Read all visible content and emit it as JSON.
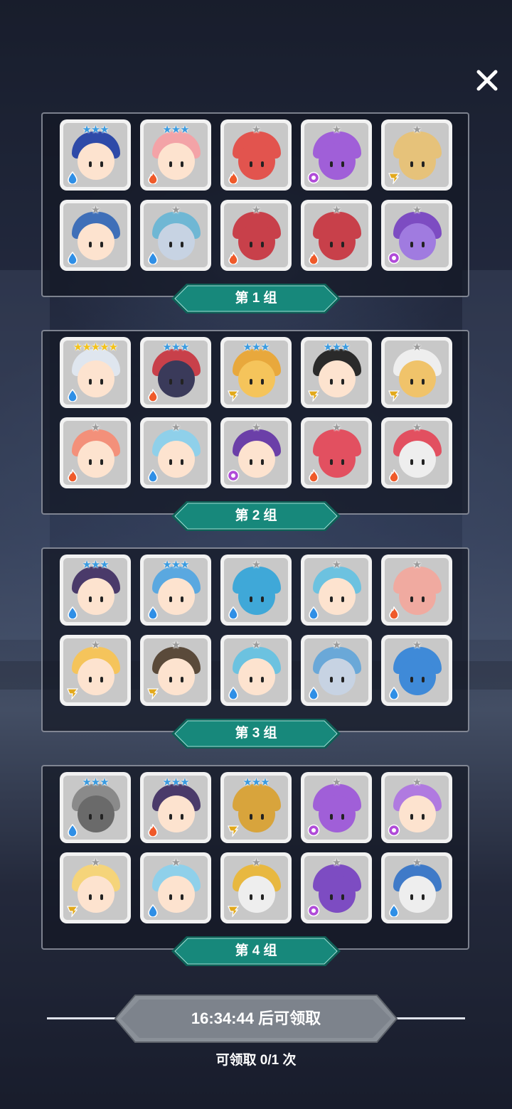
{
  "close_icon": "close-icon",
  "groups": [
    {
      "label": "第 1 组",
      "cards": [
        {
          "stars": "★★★",
          "tier": "blue",
          "element": "water",
          "color": "#2e4aa8",
          "skin": "#fde3cf"
        },
        {
          "stars": "★★★",
          "tier": "blue",
          "element": "fire",
          "color": "#f3a3a7",
          "skin": "#fde3cf"
        },
        {
          "stars": "★",
          "tier": "silver",
          "element": "fire",
          "color": "#e2544e",
          "skin": "#e2544e"
        },
        {
          "stars": "★",
          "tier": "silver",
          "element": "dark",
          "color": "#a05fd8",
          "skin": "#a05fd8"
        },
        {
          "stars": "★",
          "tier": "silver",
          "element": "wind",
          "color": "#e6c27a",
          "skin": "#e6c27a"
        },
        {
          "stars": "★",
          "tier": "silver",
          "element": "water",
          "color": "#3f6fb8",
          "skin": "#fde3cf"
        },
        {
          "stars": "★",
          "tier": "silver",
          "element": "water",
          "color": "#6fb7d4",
          "skin": "#c7d3e3"
        },
        {
          "stars": "★",
          "tier": "silver",
          "element": "fire",
          "color": "#c8404a",
          "skin": "#c8404a"
        },
        {
          "stars": "★",
          "tier": "silver",
          "element": "fire",
          "color": "#c8404a",
          "skin": "#c8404a"
        },
        {
          "stars": "★",
          "tier": "silver",
          "element": "dark",
          "color": "#7d4cc2",
          "skin": "#a07be0"
        }
      ]
    },
    {
      "label": "第 2 组",
      "cards": [
        {
          "stars": "★★★★★",
          "tier": "gold",
          "element": "water",
          "color": "#dfe6ef",
          "skin": "#fde3cf"
        },
        {
          "stars": "★★★",
          "tier": "blue",
          "element": "fire",
          "color": "#c8404a",
          "skin": "#3a3a5a"
        },
        {
          "stars": "★★★",
          "tier": "blue",
          "element": "wind",
          "color": "#e8a83c",
          "skin": "#f5c45b"
        },
        {
          "stars": "★★★",
          "tier": "blue",
          "element": "wind",
          "color": "#2a2a2a",
          "skin": "#fde3cf"
        },
        {
          "stars": "★",
          "tier": "silver",
          "element": "wind",
          "color": "#eeeeee",
          "skin": "#f0c36a"
        },
        {
          "stars": "★",
          "tier": "silver",
          "element": "fire",
          "color": "#f3907a",
          "skin": "#fde3cf"
        },
        {
          "stars": "★",
          "tier": "silver",
          "element": "water",
          "color": "#8fd0ea",
          "skin": "#fde3cf"
        },
        {
          "stars": "★",
          "tier": "silver",
          "element": "dark",
          "color": "#6b3fa8",
          "skin": "#fde3cf"
        },
        {
          "stars": "★",
          "tier": "silver",
          "element": "fire",
          "color": "#e25060",
          "skin": "#e25060"
        },
        {
          "stars": "★",
          "tier": "silver",
          "element": "fire",
          "color": "#e25060",
          "skin": "#eeeeee"
        }
      ]
    },
    {
      "label": "第 3 组",
      "cards": [
        {
          "stars": "★★★",
          "tier": "blue",
          "element": "water",
          "color": "#4a3a6a",
          "skin": "#fde3cf"
        },
        {
          "stars": "★★★",
          "tier": "blue",
          "element": "water",
          "color": "#5aa8e0",
          "skin": "#fde3cf"
        },
        {
          "stars": "★",
          "tier": "silver",
          "element": "water",
          "color": "#3fa8d8",
          "skin": "#3fa8d8"
        },
        {
          "stars": "★",
          "tier": "silver",
          "element": "water",
          "color": "#6cc2e0",
          "skin": "#fde3cf"
        },
        {
          "stars": "★",
          "tier": "silver",
          "element": "fire",
          "color": "#f0aaa0",
          "skin": "#f0aaa0"
        },
        {
          "stars": "★",
          "tier": "silver",
          "element": "wind",
          "color": "#f5c45b",
          "skin": "#fde3cf"
        },
        {
          "stars": "★",
          "tier": "silver",
          "element": "wind",
          "color": "#5a4a3a",
          "skin": "#fde3cf"
        },
        {
          "stars": "★",
          "tier": "silver",
          "element": "water",
          "color": "#6cc2e0",
          "skin": "#fde3cf"
        },
        {
          "stars": "★",
          "tier": "silver",
          "element": "water",
          "color": "#6aa8d8",
          "skin": "#c7d3e3"
        },
        {
          "stars": "★",
          "tier": "silver",
          "element": "water",
          "color": "#3f8ad8",
          "skin": "#3f8ad8"
        }
      ]
    },
    {
      "label": "第 4 组",
      "cards": [
        {
          "stars": "★★★",
          "tier": "blue",
          "element": "water",
          "color": "#8a8a8a",
          "skin": "#6a6a6a"
        },
        {
          "stars": "★★★",
          "tier": "blue",
          "element": "fire",
          "color": "#4a3a6a",
          "skin": "#fde3cf"
        },
        {
          "stars": "★★★",
          "tier": "blue",
          "element": "wind",
          "color": "#d8a43c",
          "skin": "#d8a43c"
        },
        {
          "stars": "★",
          "tier": "silver",
          "element": "dark",
          "color": "#a05fd8",
          "skin": "#a05fd8"
        },
        {
          "stars": "★",
          "tier": "silver",
          "element": "dark",
          "color": "#b07ae0",
          "skin": "#fde3cf"
        },
        {
          "stars": "★",
          "tier": "silver",
          "element": "wind",
          "color": "#f5d47a",
          "skin": "#fde3cf"
        },
        {
          "stars": "★",
          "tier": "silver",
          "element": "water",
          "color": "#8fd0ea",
          "skin": "#fde3cf"
        },
        {
          "stars": "★",
          "tier": "silver",
          "element": "wind",
          "color": "#e8b840",
          "skin": "#eeeeee"
        },
        {
          "stars": "★",
          "tier": "silver",
          "element": "dark",
          "color": "#7d4cc2",
          "skin": "#7d4cc2"
        },
        {
          "stars": "★",
          "tier": "silver",
          "element": "water",
          "color": "#3f7ac8",
          "skin": "#eeeeee"
        }
      ]
    }
  ],
  "timer": {
    "text": "16:34:44 后可领取"
  },
  "claim": {
    "text": "可领取 0/1 次"
  },
  "colors": {
    "label_teal": "#17887b",
    "label_border": "#0e5f56",
    "element_water": "#2f8fe6",
    "element_fire": "#ef5a2a",
    "element_dark": "#b04bd8",
    "element_wind": "#e2a91c"
  }
}
